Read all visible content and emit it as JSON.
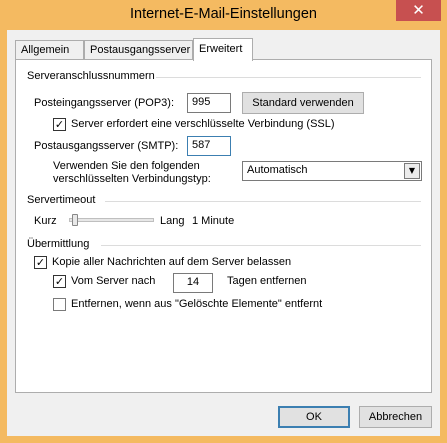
{
  "window": {
    "title": "Internet-E-Mail-Einstellungen",
    "close_glyph": "✕",
    "frame_color": "#f4ba61",
    "close_color": "#c75050"
  },
  "tabs": [
    {
      "label": "Allgemein",
      "active": false
    },
    {
      "label": "Postausgangsserver",
      "active": false
    },
    {
      "label": "Erweitert",
      "active": true
    }
  ],
  "server_ports": {
    "group_title": "Serveranschlussnummern",
    "incoming_label": "Posteingangsserver (POP3):",
    "incoming_value": "995",
    "default_button": "Standard verwenden",
    "ssl_checkbox": {
      "label": "Server erfordert eine verschlüsselte Verbindung (SSL)",
      "checked": true
    },
    "outgoing_label": "Postausgangsserver (SMTP):",
    "outgoing_value": "587",
    "encryption_label_line1": "Verwenden Sie den folgenden",
    "encryption_label_line2": "verschlüsselten Verbindungstyp:",
    "encryption_value": "Automatisch"
  },
  "timeout": {
    "group_title": "Servertimeout",
    "short_label": "Kurz",
    "long_label": "Lang",
    "value_text": "1 Minute",
    "slider_fraction": 0.04
  },
  "delivery": {
    "group_title": "Übermittlung",
    "keep_copy": {
      "label": "Kopie aller Nachrichten auf dem Server belassen",
      "checked": true
    },
    "remove_after": {
      "label_before": "Vom Server nach",
      "days": "14",
      "label_after": "Tagen entfernen",
      "checked": true
    },
    "remove_deleted": {
      "label": "Entfernen, wenn aus \"Gelöschte Elemente\" entfernt",
      "checked": false
    }
  },
  "footer": {
    "ok_label": "OK",
    "cancel_label": "Abbrechen"
  },
  "glyphs": {
    "check": "✓",
    "dropdown_arrow": "▼"
  }
}
